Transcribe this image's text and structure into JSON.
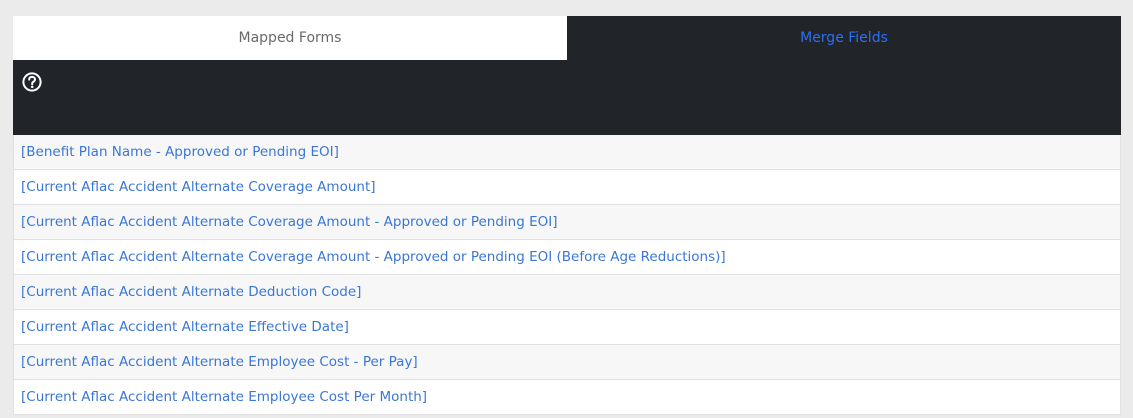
{
  "tabs": {
    "mapped_forms": "Mapped Forms",
    "merge_fields": "Merge Fields",
    "active": "merge_fields"
  },
  "toolbar": {
    "help_icon": "question-circle-icon"
  },
  "merge_fields": [
    "[Benefit Plan Name - Approved or Pending EOI]",
    "[Current Aflac Accident Alternate Coverage Amount]",
    "[Current Aflac Accident Alternate Coverage Amount - Approved or Pending EOI]",
    "[Current Aflac Accident Alternate Coverage Amount - Approved or Pending EOI (Before Age Reductions)]",
    "[Current Aflac Accident Alternate Deduction Code]",
    "[Current Aflac Accident Alternate Effective Date]",
    "[Current Aflac Accident Alternate Employee Cost - Per Pay]",
    "[Current Aflac Accident Alternate Employee Cost Per Month]"
  ],
  "colors": {
    "dark_background": "#212429",
    "link": "#3a77d4",
    "active_tab_text": "#2b6ef2",
    "inactive_tab_text": "#6a6a6a",
    "page_background": "#ebebeb"
  }
}
